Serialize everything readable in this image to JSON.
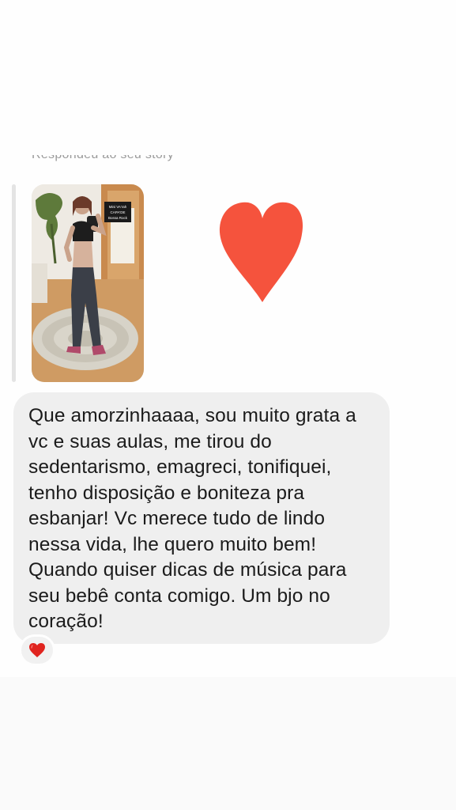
{
  "reply": {
    "caption": "Respondeu ao seu story"
  },
  "story_sign": {
    "lines": [
      "Mini VA'rah",
      "CAPA'DE",
      "Bossa Rock"
    ]
  },
  "message": {
    "text": "Que amorzinhaaaa, sou muito grata a\nvc e suas aulas, me tirou do\nsedentarismo, emagreci, tonifiquei,\ntenho disposição e boniteza pra\nesbanjar! Vc merece tudo de lindo\nnessa vida, lhe quero muito bem!\nQuando quiser dicas de música para\nseu bebê conta comigo. Um bjo no\ncoração!"
  },
  "reaction": {
    "icon": "red-heart-icon"
  },
  "colors": {
    "bubble": "#efefef",
    "heart": "#f5533d",
    "text": "#1b1b1b"
  }
}
